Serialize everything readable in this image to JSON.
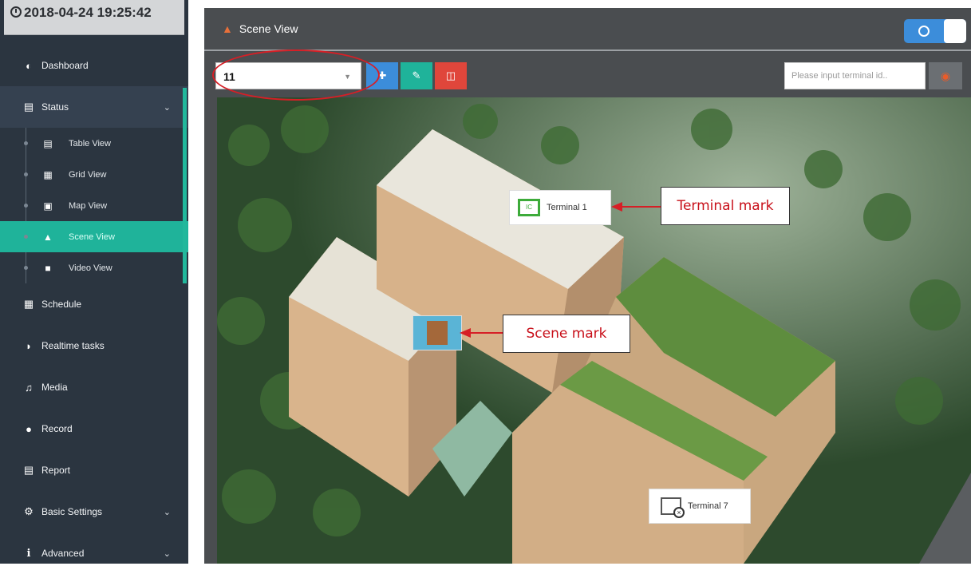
{
  "clock": {
    "datetime": "2018-04-24 19:25:42"
  },
  "nav": {
    "dashboard": "Dashboard",
    "status": "Status",
    "sub": {
      "table_view": "Table View",
      "grid_view": "Grid View",
      "map_view": "Map View",
      "scene_view": "Scene View",
      "video_view": "Video View"
    },
    "schedule": "Schedule",
    "realtime_tasks": "Realtime tasks",
    "media": "Media",
    "record": "Record",
    "report": "Report",
    "basic_settings": "Basic Settings",
    "advanced": "Advanced"
  },
  "panel": {
    "title": "Scene View"
  },
  "toolbar": {
    "scene_select_value": "11",
    "search_placeholder": "Please input terminal id.."
  },
  "marks": {
    "terminal1_label": "Terminal 1",
    "terminal7_label": "Terminal 7"
  },
  "annotations": {
    "terminal_mark": "Terminal mark",
    "scene_mark": "Scene mark"
  },
  "colors": {
    "sidebar_bg": "#2b3540",
    "active_accent": "#1fb39a",
    "add_button": "#3c8dda",
    "edit_button": "#1fb39a",
    "delete_button": "#e0463b",
    "annotation_red": "#c8101a"
  }
}
